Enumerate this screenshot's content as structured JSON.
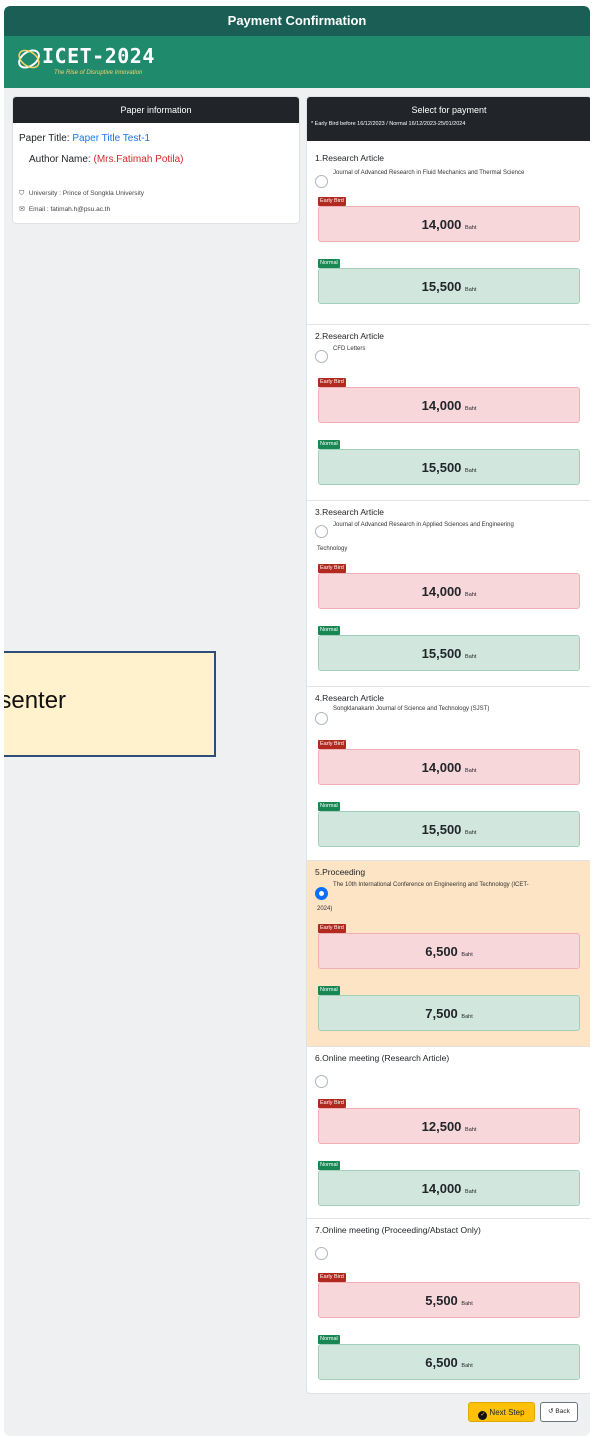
{
  "header": {
    "title": "Payment Confirmation"
  },
  "banner": {
    "logo_text": "ICET-2024",
    "tagline": "The Rise of Disruptive Innovation"
  },
  "paper_info": {
    "heading": "Paper information",
    "title_label": "Paper Title:",
    "title_value": "Paper Title Test-1",
    "author_label": "Author Name:",
    "author_value": "(Mrs.Fatimah Potila)",
    "university": "University : Prince of Songkla University",
    "email": "Email : fatimah.h@psu.ac.th"
  },
  "presenter_overlay": {
    "text": "esenter"
  },
  "payment": {
    "heading": "Select for payment",
    "note": "* Early Bird before 16/12/2023 / Normal 16/12/2023-25/01/2024",
    "early_label": "Early Bird",
    "normal_label": "Normal",
    "unit": "Baht",
    "options": [
      {
        "title": "1.Research Article",
        "journal": "Journal of Advanced Research in Fluid Mechanics and Thermal Science",
        "journal_cont": "",
        "early": "14,000",
        "normal": "15,500",
        "selected": false
      },
      {
        "title": "2.Research Article",
        "journal": "CFD Letters",
        "journal_cont": "",
        "early": "14,000",
        "normal": "15,500",
        "selected": false
      },
      {
        "title": "3.Research Article",
        "journal": "Journal of Advanced Research in Applied Sciences and Engineering",
        "journal_cont": "Technology",
        "early": "14,000",
        "normal": "15,500",
        "selected": false
      },
      {
        "title": "4.Research Article",
        "journal": "Songklanakarin Journal of Science and Technology (SJST)",
        "journal_cont": "",
        "early": "14,000",
        "normal": "15,500",
        "selected": false
      },
      {
        "title": "5.Proceeding",
        "journal": "The 10th International Conference on Engineering and Technology (ICET-",
        "journal_cont": "2024)",
        "early": "6,500",
        "normal": "7,500",
        "selected": true
      },
      {
        "title": "6.Online meeting (Research Article)",
        "journal": "",
        "journal_cont": "",
        "early": "12,500",
        "normal": "14,000",
        "selected": false
      },
      {
        "title": "7.Online meeting (Proceeding/Abstact Only)",
        "journal": "",
        "journal_cont": "",
        "early": "5,500",
        "normal": "6,500",
        "selected": false
      }
    ]
  },
  "actions": {
    "next_label": "Next Step",
    "back_label": "Back"
  }
}
